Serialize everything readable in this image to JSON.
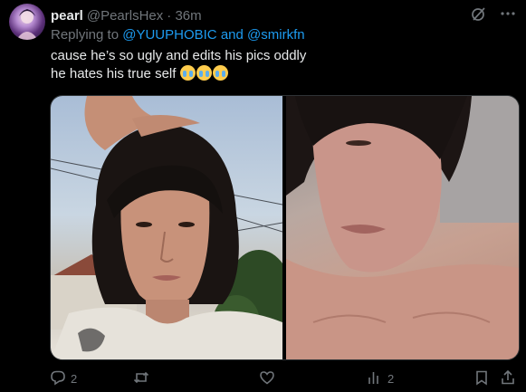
{
  "author": {
    "name": "pearl",
    "handle": "@PearlsHex",
    "time": "· 36m"
  },
  "reply": {
    "prefix": "Replying to",
    "mention1": "@YUUPHOBIC",
    "conjunction": "and",
    "mention2": "@smirkfn"
  },
  "tweet": {
    "line1": "cause he’s so ugly and edits his pics oddly",
    "line2": "he hates his true self"
  },
  "actions": {
    "replies": "2",
    "reposts": "",
    "likes": "",
    "views": "2"
  },
  "colors": {
    "background": "#000000",
    "text": "#e7e9ea",
    "muted": "#71767b",
    "link": "#1d9bf0"
  },
  "icons": [
    "grok-icon",
    "more-icon",
    "reply-icon",
    "repost-icon",
    "like-icon",
    "views-icon",
    "bookmark-icon",
    "share-icon",
    "loudly-crying-face-emoji"
  ]
}
